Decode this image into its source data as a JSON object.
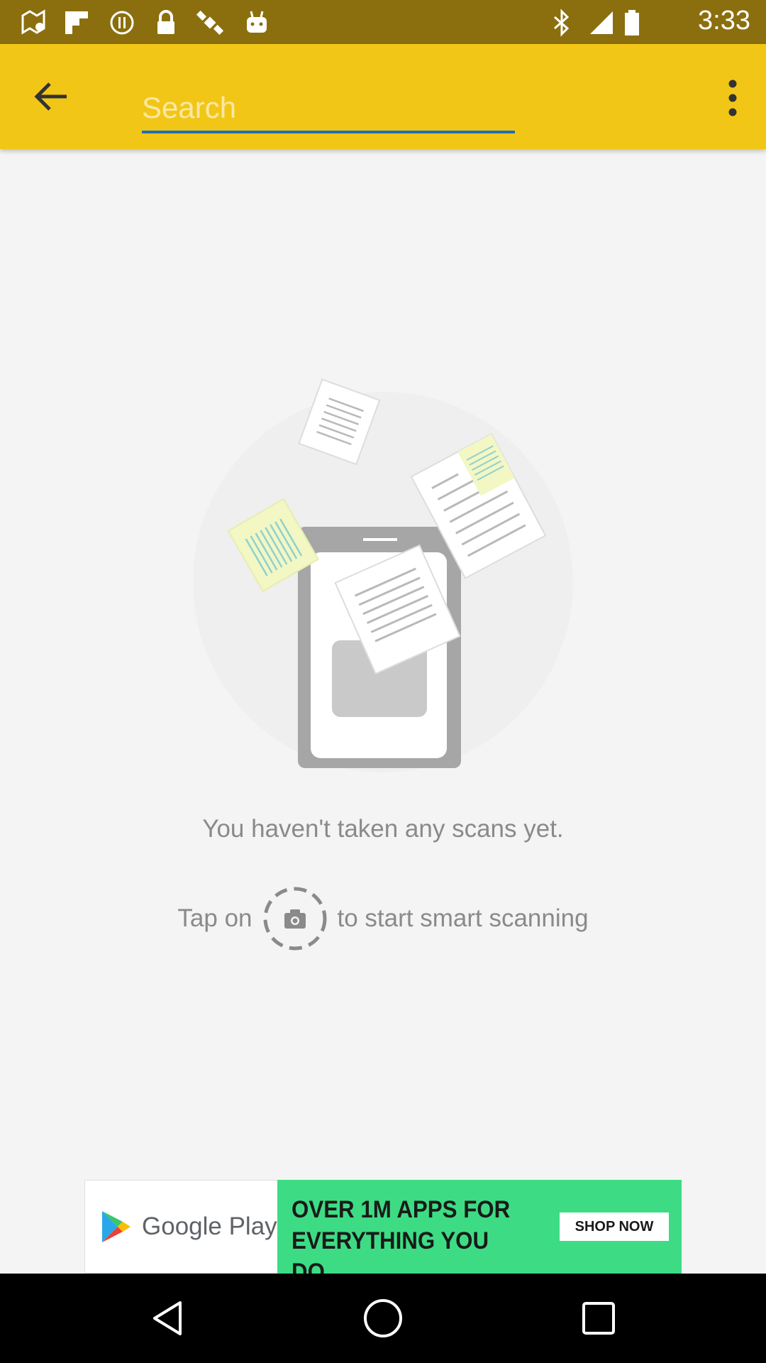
{
  "status_bar": {
    "time": "3:33",
    "left_icons": [
      "map-icon",
      "flipboard-icon",
      "data-saver-icon",
      "lock-icon",
      "satellite-icon",
      "android-icon"
    ],
    "right_icons": [
      "bluetooth-icon",
      "signal-icon",
      "battery-icon"
    ]
  },
  "app_bar": {
    "color": "#f2c617",
    "search": {
      "placeholder": "Search",
      "value": ""
    }
  },
  "empty_state": {
    "title": "You haven't taken any scans yet.",
    "hint_prefix": "Tap on",
    "hint_suffix": "to start smart scanning"
  },
  "ad": {
    "brand": "Google Play",
    "headline_line1": "OVER 1M APPS FOR",
    "headline_line2": "EVERYTHING YOU DO",
    "cta": "SHOP NOW",
    "accent": "#3ddc84"
  },
  "nav": {
    "icons": [
      "back-triangle-icon",
      "home-circle-icon",
      "recents-square-icon"
    ]
  }
}
